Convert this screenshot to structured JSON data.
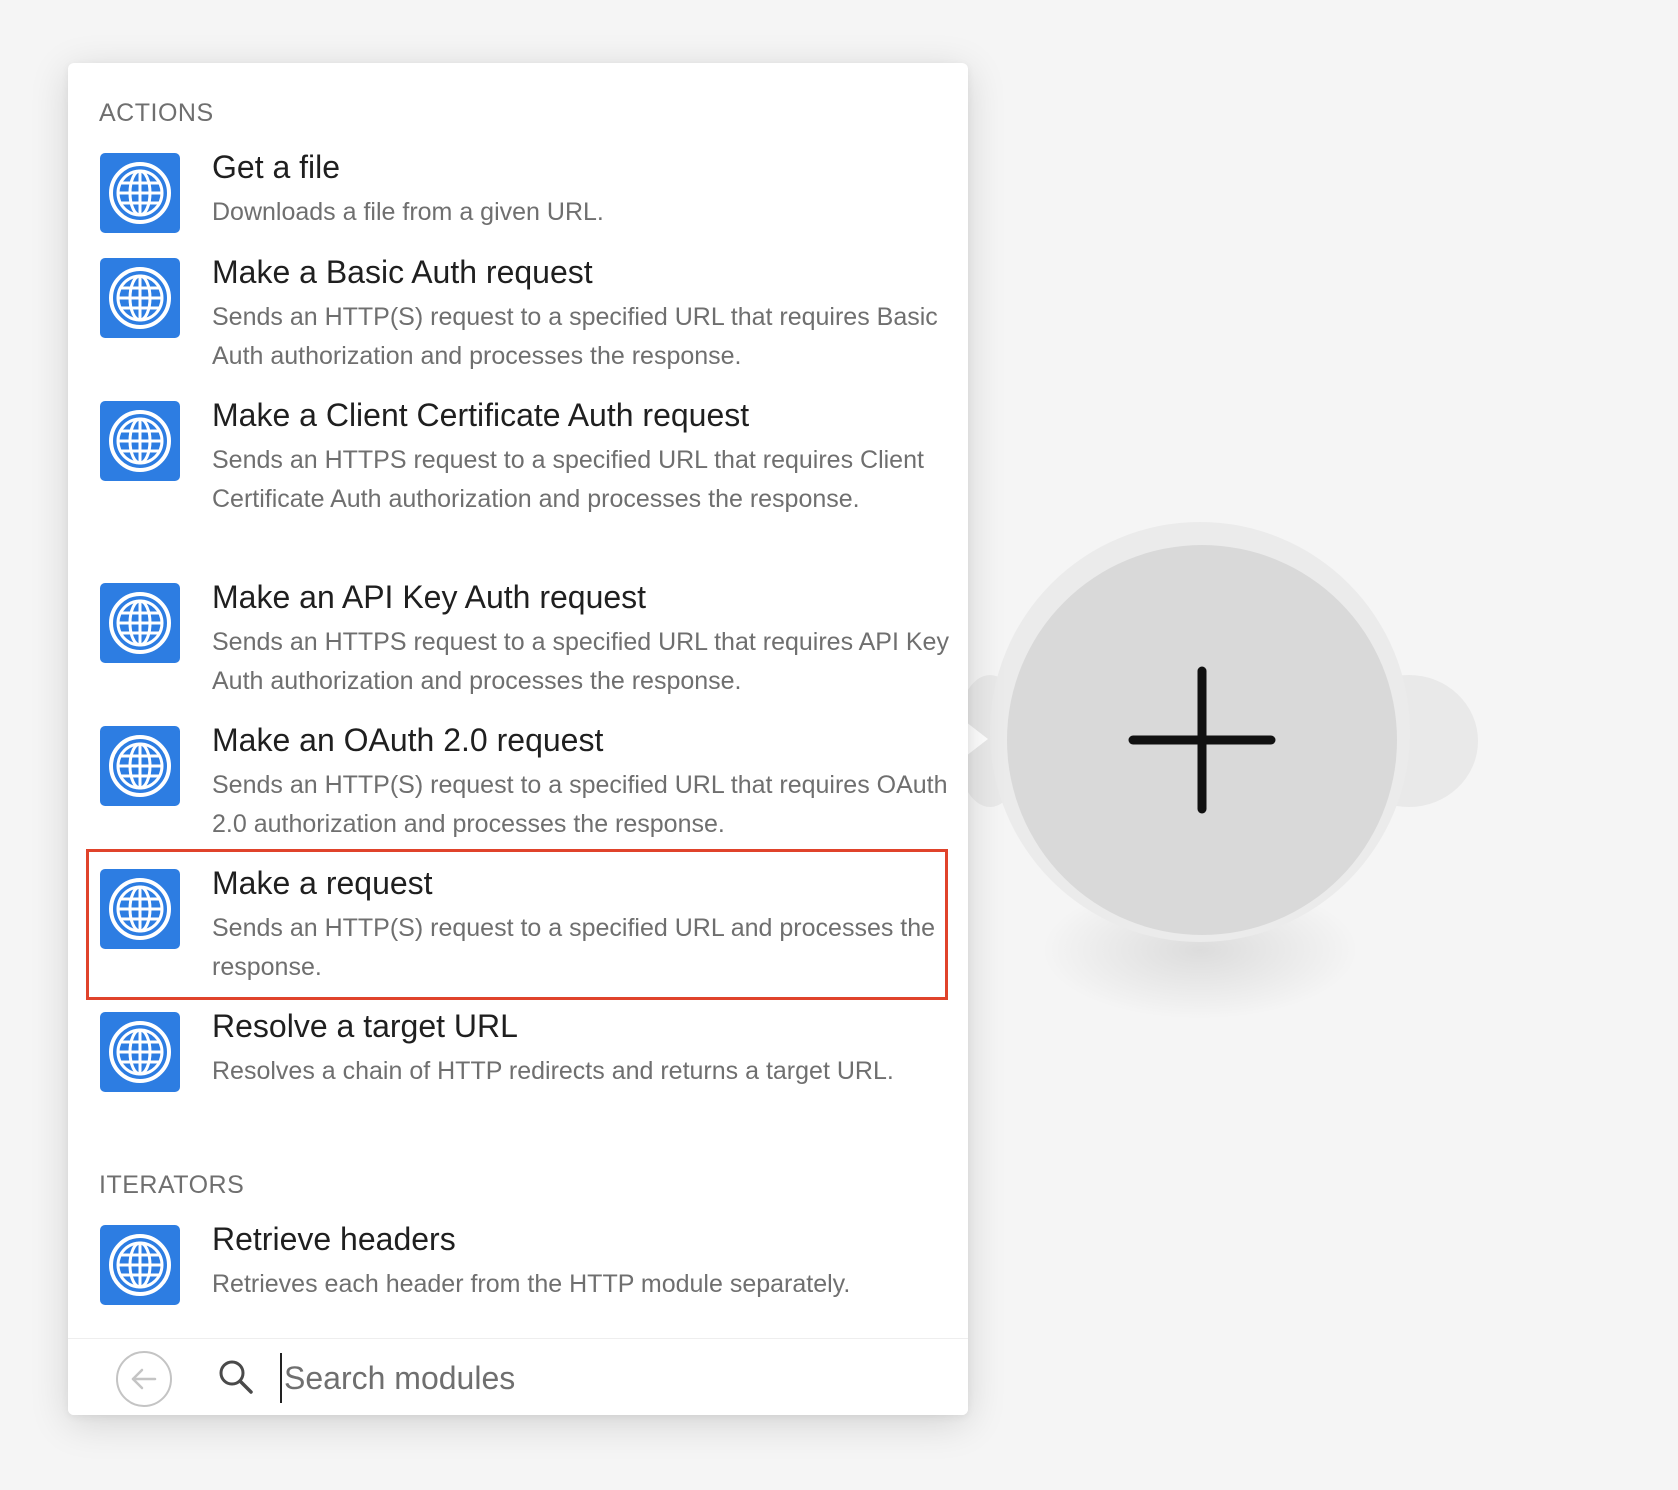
{
  "panel": {
    "sections": [
      {
        "label": "ACTIONS"
      },
      {
        "label": "ITERATORS"
      }
    ],
    "actions": [
      {
        "title": "Get a file",
        "desc": "Downloads a file from a given URL.",
        "icon": "globe-icon"
      },
      {
        "title": "Make a Basic Auth request",
        "desc": "Sends an HTTP(S) request to a specified URL that requires Basic Auth authorization and processes the response.",
        "icon": "globe-icon"
      },
      {
        "title": "Make a Client Certificate Auth request",
        "desc": "Sends an HTTPS request to a specified URL that requires Client Certificate Auth authorization and processes the response.",
        "icon": "globe-icon"
      },
      {
        "title": "Make an API Key Auth request",
        "desc": "Sends an HTTPS request to a specified URL that requires API Key Auth authorization and processes the response.",
        "icon": "globe-icon"
      },
      {
        "title": "Make an OAuth 2.0 request",
        "desc": "Sends an HTTP(S) request to a specified URL that requires OAuth 2.0 authorization and processes the response.",
        "icon": "globe-icon"
      },
      {
        "title": "Make a request",
        "desc": "Sends an HTTP(S) request to a specified URL and processes the response.",
        "icon": "globe-icon",
        "highlighted": true
      },
      {
        "title": "Resolve a target URL",
        "desc": "Resolves a chain of HTTP redirects and returns a target URL.",
        "icon": "globe-icon"
      }
    ],
    "iterators": [
      {
        "title": "Retrieve headers",
        "desc": "Retrieves each header from the HTTP module separately.",
        "icon": "globe-icon"
      }
    ],
    "search": {
      "placeholder": "Search modules",
      "value": ""
    },
    "highlight_color": "#e0432b",
    "icon_color": "#2d7de2"
  },
  "node": {
    "icon": "plus-icon"
  }
}
